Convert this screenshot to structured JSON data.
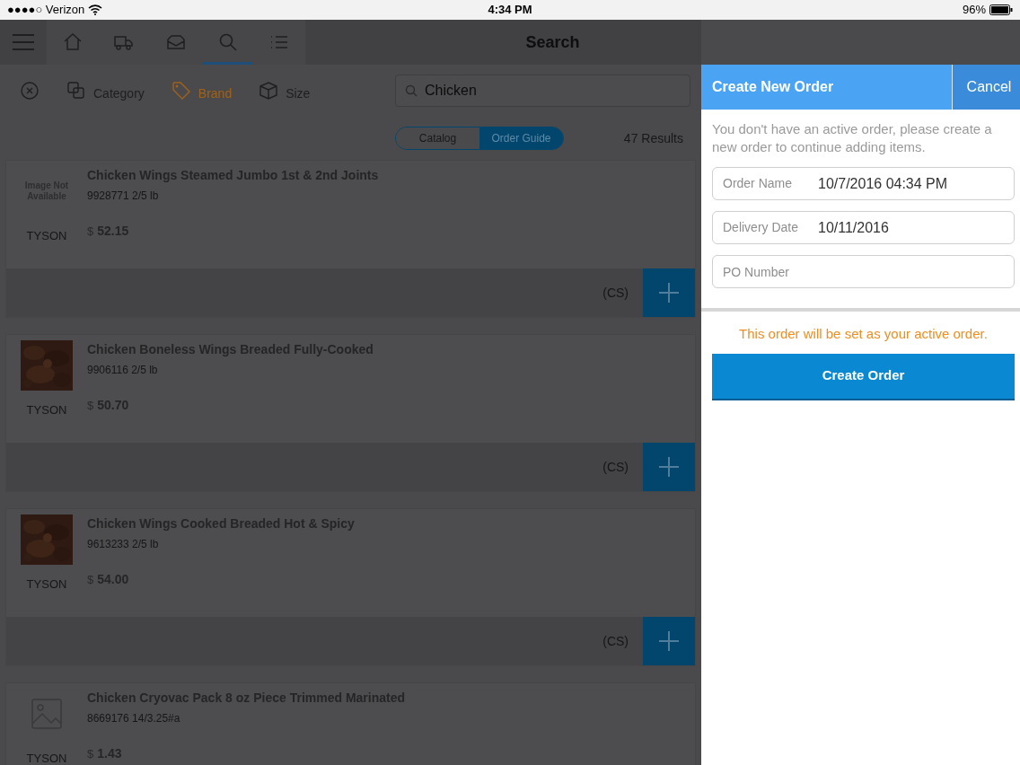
{
  "status_bar": {
    "carrier": "●●●●○ Verizon",
    "time": "4:34 PM",
    "battery": "96%"
  },
  "header": {
    "title": "Search"
  },
  "nav_tabs": [
    {
      "kind": "home",
      "selected": false
    },
    {
      "kind": "truck",
      "selected": false
    },
    {
      "kind": "inbox",
      "selected": false
    },
    {
      "kind": "search",
      "selected": true
    },
    {
      "kind": "list",
      "selected": false
    }
  ],
  "filters": [
    {
      "kind": "clear",
      "active": false
    },
    {
      "kind": "category",
      "label": "Category",
      "active": false
    },
    {
      "kind": "brand",
      "label": "Brand",
      "active": true
    },
    {
      "kind": "size",
      "label": "Size",
      "active": false
    }
  ],
  "search": {
    "value": "Chicken"
  },
  "segments": [
    {
      "label": "Catalog",
      "selected": false
    },
    {
      "label": "Order Guide",
      "selected": true
    }
  ],
  "results_count": "47 Results",
  "items": [
    {
      "kind": "none",
      "image_text": "Image Not Available",
      "brand": "TYSON",
      "name": "Chicken Wings Steamed Jumbo 1st & 2nd Joints",
      "code": "9928771 2/5 lb",
      "currency": "$",
      "price": "52.15",
      "unit": "(CS)"
    },
    {
      "brand": "TYSON",
      "name": "Chicken Boneless Wings Breaded Fully-Cooked",
      "code": "9906116 2/5 lb",
      "currency": "$",
      "price": "50.70",
      "unit": "(CS)"
    },
    {
      "brand": "TYSON",
      "name": "Chicken Wings Cooked Breaded Hot & Spicy",
      "code": "9613233 2/5 lb",
      "currency": "$",
      "price": "54.00",
      "unit": "(CS)"
    },
    {
      "kind": "placeholder",
      "brand": "TYSON",
      "name": "Chicken Cryovac Pack 8 oz Piece Trimmed Marinated",
      "code": "8669176 14/3.25#a",
      "currency": "$",
      "price": "1.43"
    }
  ],
  "panel": {
    "title": "Create New Order",
    "cancel": "Cancel",
    "message": "You don't have an active order, please create a new order to continue adding items.",
    "fields": [
      {
        "label": "Order Name",
        "value": "10/7/2016 04:34 PM"
      },
      {
        "label": "Delivery Date",
        "value": "10/11/2016"
      },
      {
        "placeholder": "PO Number"
      }
    ],
    "notice": "This order will be set as your active order.",
    "button": "Create Order"
  }
}
